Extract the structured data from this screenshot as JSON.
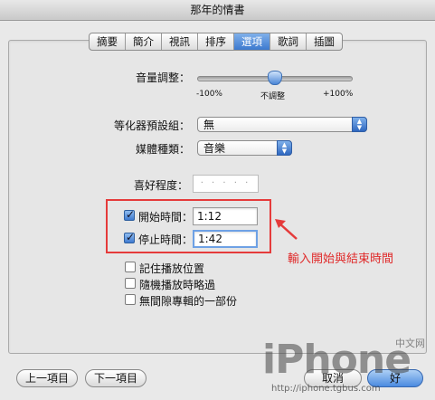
{
  "window": {
    "title": "那年的情書"
  },
  "tabs": [
    {
      "label": "摘要",
      "selected": false
    },
    {
      "label": "簡介",
      "selected": false
    },
    {
      "label": "視訊",
      "selected": false
    },
    {
      "label": "排序",
      "selected": false
    },
    {
      "label": "選項",
      "selected": true
    },
    {
      "label": "歌詞",
      "selected": false
    },
    {
      "label": "插圖",
      "selected": false
    }
  ],
  "volume": {
    "label": "音量調整：",
    "min_label": "-100%",
    "center_label": "不調整",
    "max_label": "+100%",
    "value_percent": 0
  },
  "eq_preset": {
    "label": "等化器預設組：",
    "value": "無"
  },
  "media_kind": {
    "label": "媒體種類：",
    "value": "音樂"
  },
  "rating": {
    "label": "喜好程度：",
    "stars": "· · · · ·",
    "value": 0
  },
  "start_time": {
    "label": "開始時間：",
    "checked": true,
    "value": "1:12"
  },
  "stop_time": {
    "label": "停止時間：",
    "checked": true,
    "value": "1:42"
  },
  "annotation": {
    "text": "輸入開始與結束時間"
  },
  "checkboxes": [
    {
      "label": "記住播放位置",
      "checked": false
    },
    {
      "label": "隨機播放時略過",
      "checked": false
    },
    {
      "label": "無間隙專輯的一部份",
      "checked": false
    }
  ],
  "buttons": {
    "previous": "上一項目",
    "next": "下一項目",
    "cancel": "取消",
    "ok": "好"
  },
  "watermark": {
    "brand": "iPhone",
    "cn": "中文网",
    "url": "http://iphone.tgbus.com"
  },
  "colors": {
    "accent": "#3d79cf",
    "annotation": "#e02a2a"
  }
}
